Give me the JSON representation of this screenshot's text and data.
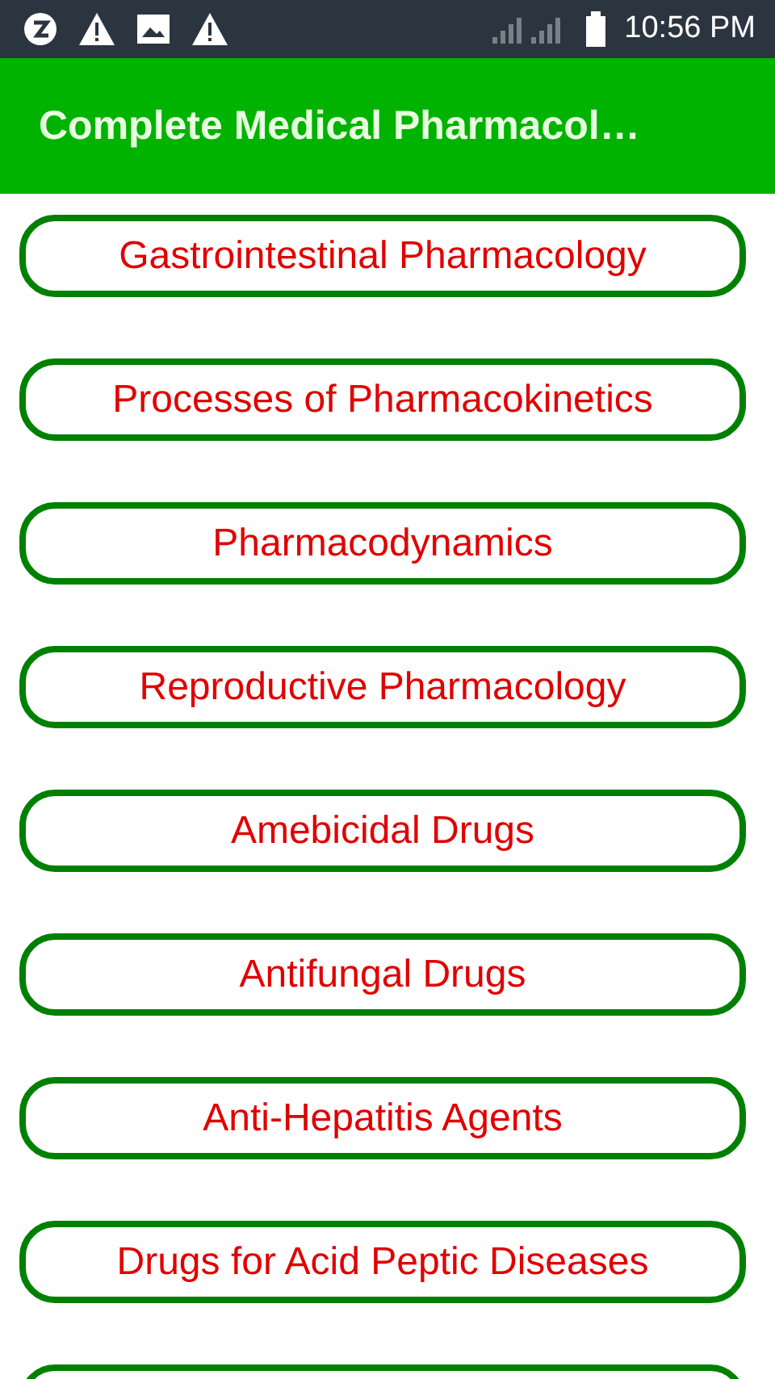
{
  "status_bar": {
    "time": "10:56 PM"
  },
  "app_bar": {
    "title": "Complete Medical Pharmacol…"
  },
  "topics": [
    {
      "label": "Gastrointestinal Pharmacology"
    },
    {
      "label": "Processes of Pharmacokinetics"
    },
    {
      "label": "Pharmacodynamics"
    },
    {
      "label": "Reproductive Pharmacology"
    },
    {
      "label": "Amebicidal Drugs"
    },
    {
      "label": "Antifungal Drugs"
    },
    {
      "label": "Anti-Hepatitis Agents"
    },
    {
      "label": "Drugs for Acid Peptic Diseases"
    }
  ],
  "more_below": true
}
